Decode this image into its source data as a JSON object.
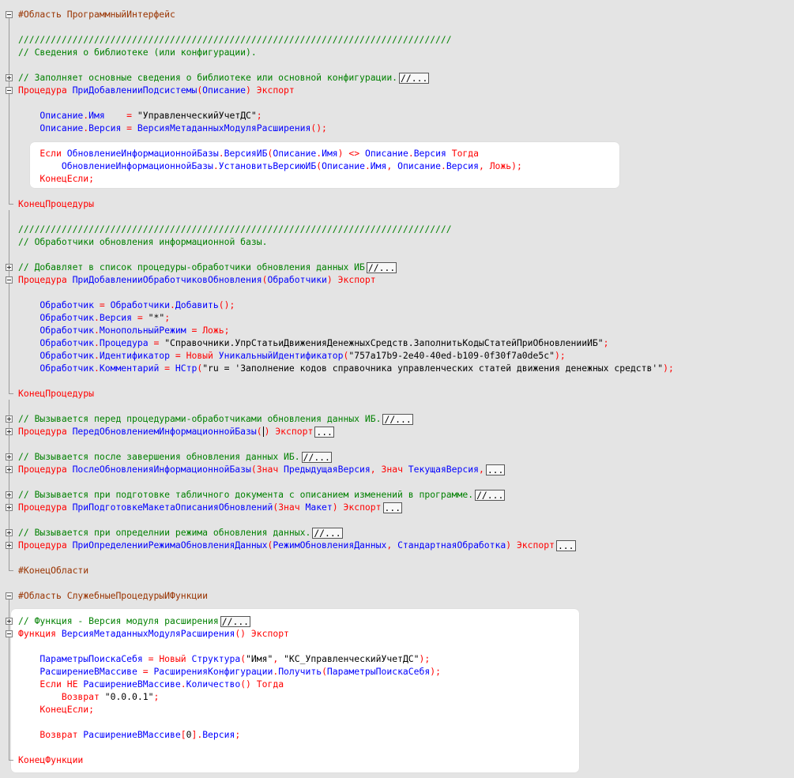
{
  "colors": {
    "keyword": "#ff0000",
    "identifier": "#0000ff",
    "comment": "#008000",
    "preprocessor": "#993300",
    "background": "#e4e4e4",
    "highlight": "#ffffff"
  },
  "lines": [
    {
      "fold": "minus-top",
      "tokens": [
        {
          "t": "#Область ПрограммныйИнтерфейс",
          "c": "p"
        }
      ]
    },
    {
      "fold": "v",
      "tokens": []
    },
    {
      "fold": "v",
      "tokens": [
        {
          "t": "////////////////////////////////////////////////////////////////////////////////",
          "c": "c"
        }
      ]
    },
    {
      "fold": "v",
      "tokens": [
        {
          "t": "// Сведения о библиотеке (или конфигурации).",
          "c": "c"
        }
      ]
    },
    {
      "fold": "v",
      "tokens": []
    },
    {
      "fold": "plus",
      "tokens": [
        {
          "t": "// Заполняет основные сведения о библиотеке или основной конфигурации.",
          "c": "c"
        },
        {
          "box": "//..."
        }
      ]
    },
    {
      "fold": "minus",
      "tokens": [
        {
          "t": "Процедура ",
          "c": "k"
        },
        {
          "t": "ПриДобавленииПодсистемы",
          "c": "i"
        },
        {
          "t": "(",
          "c": "k"
        },
        {
          "t": "Описание",
          "c": "i"
        },
        {
          "t": ") ",
          "c": "k"
        },
        {
          "t": "Экспорт",
          "c": "k"
        }
      ]
    },
    {
      "fold": "v",
      "tokens": []
    },
    {
      "fold": "v",
      "tokens": [
        {
          "t": "    Описание",
          "c": "i"
        },
        {
          "t": ".",
          "c": "k"
        },
        {
          "t": "Имя",
          "c": "i"
        },
        {
          "t": "    = ",
          "c": "k"
        },
        {
          "t": "\"УправленческийУчетДС\"",
          "c": "s"
        },
        {
          "t": ";",
          "c": "k"
        }
      ]
    },
    {
      "fold": "v",
      "tokens": [
        {
          "t": "    Описание",
          "c": "i"
        },
        {
          "t": ".",
          "c": "k"
        },
        {
          "t": "Версия",
          "c": "i"
        },
        {
          "t": " = ",
          "c": "k"
        },
        {
          "t": "ВерсияМетаданныхМодуляРасширения",
          "c": "i"
        },
        {
          "t": "();",
          "c": "k"
        }
      ]
    },
    {
      "fold": "v",
      "tokens": []
    },
    {
      "fold": "v",
      "tokens": [
        {
          "t": "    Если ",
          "c": "k"
        },
        {
          "t": "ОбновлениеИнформационнойБазы",
          "c": "i"
        },
        {
          "t": ".",
          "c": "k"
        },
        {
          "t": "ВерсияИБ",
          "c": "i"
        },
        {
          "t": "(",
          "c": "k"
        },
        {
          "t": "Описание",
          "c": "i"
        },
        {
          "t": ".",
          "c": "k"
        },
        {
          "t": "Имя",
          "c": "i"
        },
        {
          "t": ") <> ",
          "c": "k"
        },
        {
          "t": "Описание",
          "c": "i"
        },
        {
          "t": ".",
          "c": "k"
        },
        {
          "t": "Версия",
          "c": "i"
        },
        {
          "t": " Тогда",
          "c": "k"
        }
      ]
    },
    {
      "fold": "v",
      "tokens": [
        {
          "t": "        ОбновлениеИнформационнойБазы",
          "c": "i"
        },
        {
          "t": ".",
          "c": "k"
        },
        {
          "t": "УстановитьВерсиюИБ",
          "c": "i"
        },
        {
          "t": "(",
          "c": "k"
        },
        {
          "t": "Описание",
          "c": "i"
        },
        {
          "t": ".",
          "c": "k"
        },
        {
          "t": "Имя",
          "c": "i"
        },
        {
          "t": ", ",
          "c": "k"
        },
        {
          "t": "Описание",
          "c": "i"
        },
        {
          "t": ".",
          "c": "k"
        },
        {
          "t": "Версия",
          "c": "i"
        },
        {
          "t": ", ",
          "c": "k"
        },
        {
          "t": "Ложь",
          "c": "k"
        },
        {
          "t": ");",
          "c": "k"
        }
      ]
    },
    {
      "fold": "v",
      "tokens": [
        {
          "t": "    КонецЕсли;",
          "c": "k"
        }
      ]
    },
    {
      "fold": "v",
      "tokens": []
    },
    {
      "fold": "end",
      "tokens": [
        {
          "t": "КонецПроцедуры",
          "c": "k"
        }
      ]
    },
    {
      "fold": "v",
      "tokens": []
    },
    {
      "fold": "v",
      "tokens": [
        {
          "t": "////////////////////////////////////////////////////////////////////////////////",
          "c": "c"
        }
      ]
    },
    {
      "fold": "v",
      "tokens": [
        {
          "t": "// Обработчики обновления информационной базы.",
          "c": "c"
        }
      ]
    },
    {
      "fold": "v",
      "tokens": []
    },
    {
      "fold": "plus",
      "tokens": [
        {
          "t": "// Добавляет в список процедуры-обработчики обновления данных ИБ",
          "c": "c"
        },
        {
          "box": "//..."
        }
      ]
    },
    {
      "fold": "minus",
      "tokens": [
        {
          "t": "Процедура ",
          "c": "k"
        },
        {
          "t": "ПриДобавленииОбработчиковОбновления",
          "c": "i"
        },
        {
          "t": "(",
          "c": "k"
        },
        {
          "t": "Обработчики",
          "c": "i"
        },
        {
          "t": ") ",
          "c": "k"
        },
        {
          "t": "Экспорт",
          "c": "k"
        }
      ]
    },
    {
      "fold": "v",
      "tokens": []
    },
    {
      "fold": "v",
      "tokens": [
        {
          "t": "    Обработчик",
          "c": "i"
        },
        {
          "t": " = ",
          "c": "k"
        },
        {
          "t": "Обработчики",
          "c": "i"
        },
        {
          "t": ".",
          "c": "k"
        },
        {
          "t": "Добавить",
          "c": "i"
        },
        {
          "t": "();",
          "c": "k"
        }
      ]
    },
    {
      "fold": "v",
      "tokens": [
        {
          "t": "    Обработчик",
          "c": "i"
        },
        {
          "t": ".",
          "c": "k"
        },
        {
          "t": "Версия",
          "c": "i"
        },
        {
          "t": " = ",
          "c": "k"
        },
        {
          "t": "\"*\"",
          "c": "s"
        },
        {
          "t": ";",
          "c": "k"
        }
      ]
    },
    {
      "fold": "v",
      "tokens": [
        {
          "t": "    Обработчик",
          "c": "i"
        },
        {
          "t": ".",
          "c": "k"
        },
        {
          "t": "МонопольныйРежим",
          "c": "i"
        },
        {
          "t": " = ",
          "c": "k"
        },
        {
          "t": "Ложь",
          "c": "k"
        },
        {
          "t": ";",
          "c": "k"
        }
      ]
    },
    {
      "fold": "v",
      "tokens": [
        {
          "t": "    Обработчик",
          "c": "i"
        },
        {
          "t": ".",
          "c": "k"
        },
        {
          "t": "Процедура",
          "c": "i"
        },
        {
          "t": " = ",
          "c": "k"
        },
        {
          "t": "\"Справочники.УпрСтатьиДвиженияДенежныхСредств.ЗаполнитьКодыСтатейПриОбновленииИБ\"",
          "c": "s"
        },
        {
          "t": ";",
          "c": "k"
        }
      ]
    },
    {
      "fold": "v",
      "tokens": [
        {
          "t": "    Обработчик",
          "c": "i"
        },
        {
          "t": ".",
          "c": "k"
        },
        {
          "t": "Идентификатор",
          "c": "i"
        },
        {
          "t": " = ",
          "c": "k"
        },
        {
          "t": "Новый ",
          "c": "k"
        },
        {
          "t": "УникальныйИдентификатор",
          "c": "i"
        },
        {
          "t": "(",
          "c": "k"
        },
        {
          "t": "\"757a17b9-2e40-40ed-b109-0f30f7a0de5c\"",
          "c": "s"
        },
        {
          "t": ");",
          "c": "k"
        }
      ]
    },
    {
      "fold": "v",
      "tokens": [
        {
          "t": "    Обработчик",
          "c": "i"
        },
        {
          "t": ".",
          "c": "k"
        },
        {
          "t": "Комментарий",
          "c": "i"
        },
        {
          "t": " = ",
          "c": "k"
        },
        {
          "t": "НСтр",
          "c": "i"
        },
        {
          "t": "(",
          "c": "k"
        },
        {
          "t": "\"ru = 'Заполнение кодов справочника управленческих статей движения денежных средств'\"",
          "c": "s"
        },
        {
          "t": ");",
          "c": "k"
        }
      ]
    },
    {
      "fold": "v",
      "tokens": []
    },
    {
      "fold": "end",
      "tokens": [
        {
          "t": "КонецПроцедуры",
          "c": "k"
        }
      ]
    },
    {
      "fold": "v",
      "tokens": []
    },
    {
      "fold": "plus",
      "tokens": [
        {
          "t": "// Вызывается перед процедурами-обработчиками обновления данных ИБ.",
          "c": "c"
        },
        {
          "box": "//..."
        }
      ]
    },
    {
      "fold": "plus",
      "tokens": [
        {
          "t": "Процедура ",
          "c": "k"
        },
        {
          "t": "ПередОбновлениемИнформационнойБазы",
          "c": "i"
        },
        {
          "t": "(",
          "c": "k"
        },
        {
          "cursor": true
        },
        {
          "t": ") ",
          "c": "k"
        },
        {
          "t": "Экспорт",
          "c": "k"
        },
        {
          "box": "..."
        }
      ]
    },
    {
      "fold": "v",
      "tokens": []
    },
    {
      "fold": "plus",
      "tokens": [
        {
          "t": "// Вызывается после завершения обновления данных ИБ.",
          "c": "c"
        },
        {
          "box": "//..."
        }
      ]
    },
    {
      "fold": "plus",
      "tokens": [
        {
          "t": "Процедура ",
          "c": "k"
        },
        {
          "t": "ПослеОбновленияИнформационнойБазы",
          "c": "i"
        },
        {
          "t": "(",
          "c": "k"
        },
        {
          "t": "Знач ",
          "c": "k"
        },
        {
          "t": "ПредыдущаяВерсия",
          "c": "i"
        },
        {
          "t": ", ",
          "c": "k"
        },
        {
          "t": "Знач ",
          "c": "k"
        },
        {
          "t": "ТекущаяВерсия",
          "c": "i"
        },
        {
          "t": ",",
          "c": "k"
        },
        {
          "box": "..."
        }
      ]
    },
    {
      "fold": "v",
      "tokens": []
    },
    {
      "fold": "plus",
      "tokens": [
        {
          "t": "// Вызывается при подготовке табличного документа с описанием изменений в программе.",
          "c": "c"
        },
        {
          "box": "//..."
        }
      ]
    },
    {
      "fold": "plus",
      "tokens": [
        {
          "t": "Процедура ",
          "c": "k"
        },
        {
          "t": "ПриПодготовкеМакетаОписанияОбновлений",
          "c": "i"
        },
        {
          "t": "(",
          "c": "k"
        },
        {
          "t": "Знач ",
          "c": "k"
        },
        {
          "t": "Макет",
          "c": "i"
        },
        {
          "t": ") ",
          "c": "k"
        },
        {
          "t": "Экспорт",
          "c": "k"
        },
        {
          "box": "..."
        }
      ]
    },
    {
      "fold": "v",
      "tokens": []
    },
    {
      "fold": "plus",
      "tokens": [
        {
          "t": "// Вызывается при определнии режима обновления данных.",
          "c": "c"
        },
        {
          "box": "//..."
        }
      ]
    },
    {
      "fold": "plus",
      "tokens": [
        {
          "t": "Процедура ",
          "c": "k"
        },
        {
          "t": "ПриОпределенииРежимаОбновленияДанных",
          "c": "i"
        },
        {
          "t": "(",
          "c": "k"
        },
        {
          "t": "РежимОбновленияДанных",
          "c": "i"
        },
        {
          "t": ", ",
          "c": "k"
        },
        {
          "t": "СтандартнаяОбработка",
          "c": "i"
        },
        {
          "t": ") ",
          "c": "k"
        },
        {
          "t": "Экспорт",
          "c": "k"
        },
        {
          "box": "..."
        }
      ]
    },
    {
      "fold": "v",
      "tokens": []
    },
    {
      "fold": "end",
      "tokens": [
        {
          "t": "#КонецОбласти",
          "c": "p"
        }
      ]
    },
    {
      "fold": "none",
      "tokens": []
    },
    {
      "fold": "minus-top",
      "tokens": [
        {
          "t": "#Область СлужебныеПроцедурыИФункции",
          "c": "p"
        }
      ]
    },
    {
      "fold": "v",
      "tokens": []
    },
    {
      "fold": "plus",
      "tokens": [
        {
          "t": "// Функция - Версия модуля расширения",
          "c": "c"
        },
        {
          "box": "//..."
        }
      ]
    },
    {
      "fold": "minus",
      "tokens": [
        {
          "t": "Функция ",
          "c": "k"
        },
        {
          "t": "ВерсияМетаданныхМодуляРасширения",
          "c": "i"
        },
        {
          "t": "() ",
          "c": "k"
        },
        {
          "t": "Экспорт",
          "c": "k"
        }
      ]
    },
    {
      "fold": "v",
      "tokens": []
    },
    {
      "fold": "v",
      "tokens": [
        {
          "t": "    ПараметрыПоискаСебя",
          "c": "i"
        },
        {
          "t": " = ",
          "c": "k"
        },
        {
          "t": "Новый ",
          "c": "k"
        },
        {
          "t": "Структура",
          "c": "i"
        },
        {
          "t": "(",
          "c": "k"
        },
        {
          "t": "\"Имя\"",
          "c": "s"
        },
        {
          "t": ", ",
          "c": "k"
        },
        {
          "t": "\"КС_УправленческийУчетДС\"",
          "c": "s"
        },
        {
          "t": ");",
          "c": "k"
        }
      ]
    },
    {
      "fold": "v",
      "tokens": [
        {
          "t": "    РасширениеВМассиве",
          "c": "i"
        },
        {
          "t": " = ",
          "c": "k"
        },
        {
          "t": "РасширенияКонфигурации",
          "c": "i"
        },
        {
          "t": ".",
          "c": "k"
        },
        {
          "t": "Получить",
          "c": "i"
        },
        {
          "t": "(",
          "c": "k"
        },
        {
          "t": "ПараметрыПоискаСебя",
          "c": "i"
        },
        {
          "t": ");",
          "c": "k"
        }
      ]
    },
    {
      "fold": "v",
      "tokens": [
        {
          "t": "    Если ",
          "c": "k"
        },
        {
          "t": "НЕ ",
          "c": "k"
        },
        {
          "t": "РасширениеВМассиве",
          "c": "i"
        },
        {
          "t": ".",
          "c": "k"
        },
        {
          "t": "Количество",
          "c": "i"
        },
        {
          "t": "() ",
          "c": "k"
        },
        {
          "t": "Тогда",
          "c": "k"
        }
      ]
    },
    {
      "fold": "v",
      "tokens": [
        {
          "t": "        Возврат ",
          "c": "k"
        },
        {
          "t": "\"0.0.0.1\"",
          "c": "s"
        },
        {
          "t": ";",
          "c": "k"
        }
      ]
    },
    {
      "fold": "v",
      "tokens": [
        {
          "t": "    КонецЕсли;",
          "c": "k"
        }
      ]
    },
    {
      "fold": "v",
      "tokens": []
    },
    {
      "fold": "v",
      "tokens": [
        {
          "t": "    Возврат ",
          "c": "k"
        },
        {
          "t": "РасширениеВМассиве",
          "c": "i"
        },
        {
          "t": "[",
          "c": "k"
        },
        {
          "t": "0",
          "c": "s"
        },
        {
          "t": "].",
          "c": "k"
        },
        {
          "t": "Версия",
          "c": "i"
        },
        {
          "t": ";",
          "c": "k"
        }
      ]
    },
    {
      "fold": "v",
      "tokens": []
    },
    {
      "fold": "end",
      "tokens": [
        {
          "t": "КонецФункции",
          "c": "k"
        }
      ]
    }
  ]
}
